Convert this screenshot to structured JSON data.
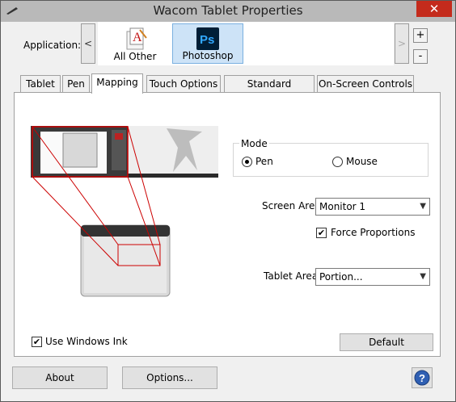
{
  "window": {
    "title": "Wacom Tablet Properties",
    "close_glyph": "✕"
  },
  "application": {
    "label": "Application:",
    "prev_glyph": "<",
    "next_glyph": ">",
    "add_glyph": "+",
    "remove_glyph": "-",
    "apps": [
      {
        "name": "All Other",
        "icon": "all-other-icon",
        "selected": false
      },
      {
        "name": "Photoshop",
        "icon": "photoshop-icon",
        "icon_text": "Ps",
        "selected": true
      }
    ]
  },
  "tabs": [
    {
      "label": "Tablet",
      "active": false
    },
    {
      "label": "Pen",
      "active": false
    },
    {
      "label": "Mapping",
      "active": true
    },
    {
      "label": "Touch Options",
      "active": false
    },
    {
      "label": "Standard Gestures",
      "active": false
    },
    {
      "label": "On-Screen Controls",
      "active": false
    }
  ],
  "mapping": {
    "mode_title": "Mode",
    "mode_options": [
      {
        "label": "Pen",
        "checked": true
      },
      {
        "label": "Mouse",
        "checked": false
      }
    ],
    "screen_area_label": "Screen Area:",
    "screen_area_value": "Monitor 1",
    "force_proportions_label": "Force Proportions",
    "force_proportions_checked": true,
    "tablet_area_label": "Tablet Area:",
    "tablet_area_value": "Portion...",
    "use_windows_ink_label": "Use Windows Ink",
    "use_windows_ink_checked": true,
    "default_label": "Default",
    "check_glyph": "✔",
    "dropdown_glyph": "▼"
  },
  "footer": {
    "about_label": "About",
    "options_label": "Options...",
    "help_glyph": "?"
  },
  "colors": {
    "titlebar": "#b9b9b9",
    "close": "#c42b1c",
    "selection": "#cde3f7",
    "mapping_lines": "#cc0000",
    "photoshop_icon": "#001e36",
    "photoshop_text": "#31a8ff"
  }
}
